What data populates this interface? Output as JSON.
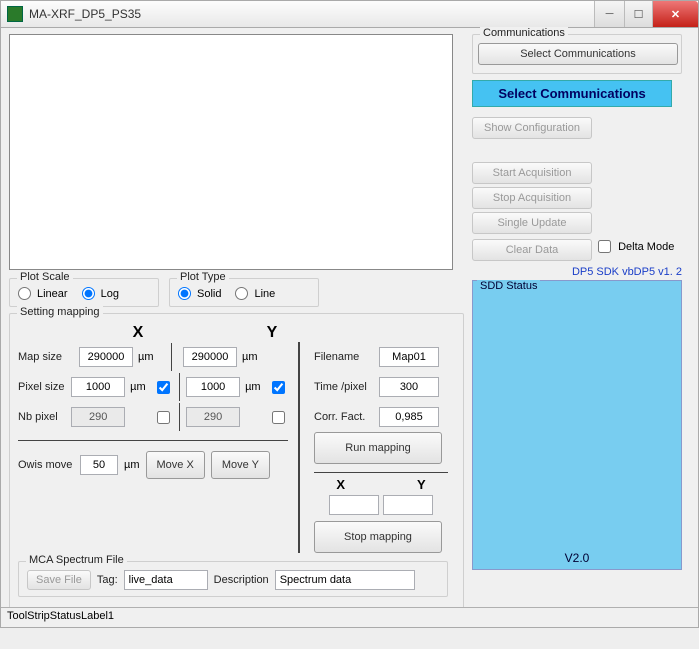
{
  "title": "MA-XRF_DP5_PS35",
  "comm": {
    "group": "Communications",
    "select_btn": "Select Communications",
    "highlight": "Select Communications",
    "show_config": "Show Configuration",
    "start_acq": "Start Acquisition",
    "stop_acq": "Stop Acquisition",
    "single_update": "Single Update",
    "clear_data": "Clear Data",
    "delta_mode": "Delta Mode"
  },
  "plot_scale": {
    "title": "Plot Scale",
    "linear": "Linear",
    "log": "Log"
  },
  "plot_type": {
    "title": "Plot Type",
    "solid": "Solid",
    "line": "Line"
  },
  "setting": {
    "title": "Setting mapping",
    "x": "X",
    "y": "Y",
    "map_size": "Map size",
    "pixel_size": "Pixel size",
    "nb_pixel": "Nb pixel",
    "um": "µm",
    "mapsize_x": "290000",
    "mapsize_y": "290000",
    "pixelsize_x": "1000",
    "pixelsize_y": "1000",
    "nb_x": "290",
    "nb_y": "290",
    "owis_move": "Owis move",
    "owis_val": "50",
    "move_x": "Move X",
    "move_y": "Move Y",
    "filename": "Filename",
    "filename_v": "Map01",
    "time_pixel": "Time /pixel",
    "time_pixel_v": "300",
    "corr_fact": "Corr. Fact.",
    "corr_fact_v": "0,985",
    "run": "Run mapping",
    "stop": "Stop mapping"
  },
  "mca": {
    "title": "MCA Spectrum File",
    "save": "Save File",
    "tag_label": "Tag:",
    "tag_v": "live_data",
    "desc_label": "Description",
    "desc_v": "Spectrum data"
  },
  "sdk_link": "DP5 SDK vbDP5 v1. 2",
  "sdd": {
    "title": "SDD Status",
    "version": "V2.0"
  },
  "status": "ToolStripStatusLabel1"
}
